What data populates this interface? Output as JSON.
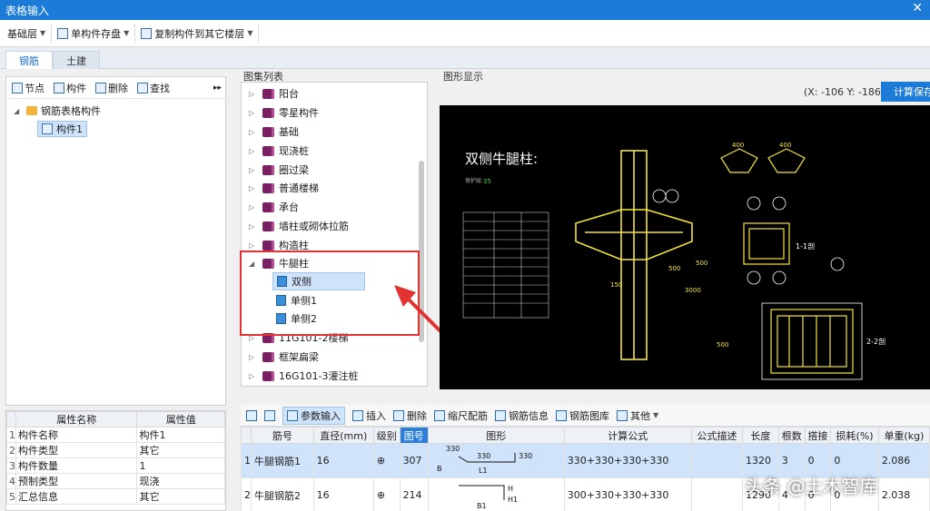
{
  "window": {
    "title": "表格输入"
  },
  "toolbar": {
    "floor_select": "基础层",
    "save_component": "单构件存盘",
    "copy_to_floors": "复制构件到其它楼层"
  },
  "tabs": [
    {
      "label": "钢筋"
    },
    {
      "label": "土建"
    }
  ],
  "left_tree": {
    "tools": [
      "节点",
      "构件",
      "删除",
      "查找"
    ],
    "root": "钢筋表格构件",
    "child": "构件1"
  },
  "properties": {
    "headers": [
      "属性名称",
      "属性值"
    ],
    "rows": [
      {
        "n": "1",
        "name": "构件名称",
        "value": "构件1"
      },
      {
        "n": "2",
        "name": "构件类型",
        "value": "其它"
      },
      {
        "n": "3",
        "name": "构件数量",
        "value": "1"
      },
      {
        "n": "4",
        "name": "预制类型",
        "value": "现浇"
      },
      {
        "n": "5",
        "name": "汇总信息",
        "value": "其它"
      }
    ]
  },
  "atlas": {
    "label": "图集列表",
    "items": [
      "阳台",
      "零星构件",
      "基础",
      "现浇桩",
      "圈过梁",
      "普通楼梯",
      "承台",
      "墙柱或砌体拉筋",
      "构造柱"
    ],
    "open": "牛腿柱",
    "open_children": [
      "双侧",
      "单侧1",
      "单侧2"
    ],
    "after": [
      "11G101-2楼梯",
      "框架扁梁",
      "16G101-3灌注桩"
    ]
  },
  "graphic": {
    "label": "图形显示",
    "coord": "(X: -106 Y: -186)",
    "calc_save": "计算保存",
    "title": "双侧牛腿柱:",
    "section_1": "1-1剖",
    "section_2": "2-2剖",
    "cover": "保护层:",
    "cover_value": "35",
    "numbers": [
      "400",
      "400",
      "500",
      "150",
      "500",
      "3000",
      "500"
    ]
  },
  "bottom_toolbar": [
    "参数输入",
    "插入",
    "删除",
    "缩尺配筋",
    "钢筋信息",
    "钢筋图库",
    "其他"
  ],
  "rebar_table": {
    "headers": [
      "筋号",
      "直径(mm)",
      "级别",
      "图号",
      "图形",
      "计算公式",
      "公式描述",
      "长度",
      "根数",
      "搭接",
      "损耗(%)",
      "单重(kg)"
    ],
    "rows": [
      {
        "n": "1",
        "name": "牛腿钢筋1",
        "dia": "16",
        "grade": "⊕",
        "fig": "307",
        "shape": [
          "330",
          "330",
          "330",
          "B",
          "L1"
        ],
        "formula": "330+330+330+330",
        "desc": "",
        "len": "1320",
        "count": "3",
        "lap": "0",
        "loss": "0",
        "weight": "2.086"
      },
      {
        "n": "2",
        "name": "牛腿钢筋2",
        "dia": "16",
        "grade": "⊕",
        "fig": "214",
        "shape": [
          "H",
          "H1",
          "B1"
        ],
        "formula": "300+330+330+330",
        "desc": "",
        "len": "1290",
        "count": "4",
        "lap": "0",
        "loss": "0",
        "weight": "2.038"
      }
    ]
  },
  "watermark": "头条 @土木智库",
  "colors": {
    "accent": "#1b7bd6",
    "highlight_box": "#e23232",
    "drawing_bg": "#000000",
    "drawing_line": "#f5e43a"
  }
}
